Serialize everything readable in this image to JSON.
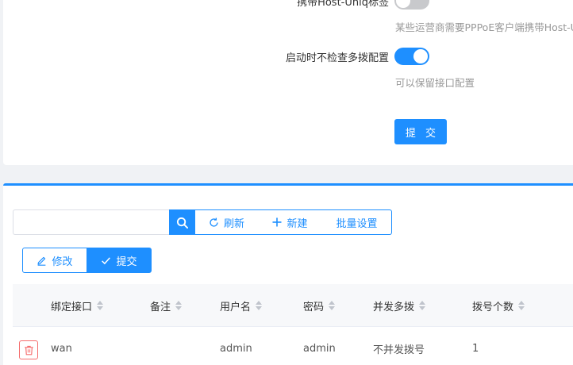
{
  "settings": {
    "host_uniq": {
      "label": "携带Host-Uniq标签",
      "enabled": false,
      "help": "某些运营商需要PPPoE客户端携带Host-Uniq"
    },
    "skip_multidial_check": {
      "label": "启动时不检查多拨配置",
      "enabled": true,
      "help": "可以保留接口配置"
    },
    "submit_label": "提 交"
  },
  "toolbar": {
    "search_placeholder": "",
    "search_icon": "search-icon",
    "refresh_label": "刷新",
    "new_label": "新建",
    "batch_label": "批量设置",
    "edit_label": "修改",
    "commit_label": "提交"
  },
  "table": {
    "columns": [
      "绑定接口",
      "备注",
      "用户名",
      "密码",
      "并发多拨",
      "拨号个数"
    ],
    "rows": [
      {
        "interface": "wan",
        "remark": "",
        "username": "admin",
        "password": "admin",
        "concurrent": "不并发拨号",
        "count": "1"
      }
    ]
  },
  "colors": {
    "accent": "#1e8fff",
    "danger": "#f56c6c"
  }
}
